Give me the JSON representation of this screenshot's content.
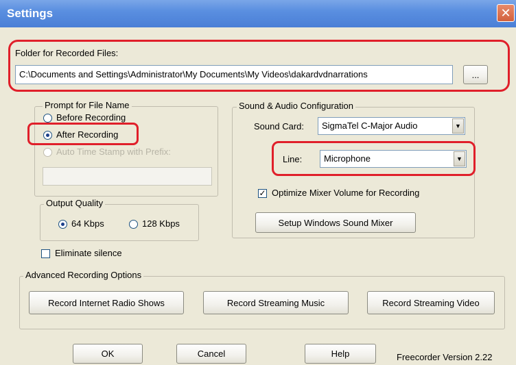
{
  "window": {
    "title": "Settings",
    "close_glyph": "✕"
  },
  "folder": {
    "label": "Folder for Recorded Files:",
    "path": "C:\\Documents and Settings\\Administrator\\My Documents\\My Videos\\dakardvdnarrations",
    "browse_label": "..."
  },
  "prompt": {
    "legend": "Prompt for File Name",
    "before": "Before Recording",
    "after": "After Recording",
    "auto": "Auto Time Stamp with Prefix:",
    "prefix_value": ""
  },
  "quality": {
    "legend": "Output Quality",
    "opt1": "64 Kbps",
    "opt2": "128 Kbps"
  },
  "eliminate_silence": "Eliminate silence",
  "sound": {
    "legend": "Sound & Audio Configuration",
    "card_label": "Sound Card:",
    "card_value": "SigmaTel C-Major Audio",
    "line_label": "Line:",
    "line_value": "Microphone",
    "optimize_label": "Optimize Mixer Volume for Recording",
    "mixer_button": "Setup Windows Sound Mixer"
  },
  "advanced": {
    "legend": "Advanced Recording Options",
    "btn_radio": "Record Internet Radio Shows",
    "btn_music": "Record Streaming Music",
    "btn_video": "Record Streaming Video"
  },
  "footer": {
    "ok": "OK",
    "cancel": "Cancel",
    "help": "Help",
    "version": "Freecorder Version 2.22"
  },
  "colors": {
    "highlight": "#e01f2a",
    "titlebar": "#5a8fe0",
    "dialog": "#ece9d8"
  }
}
